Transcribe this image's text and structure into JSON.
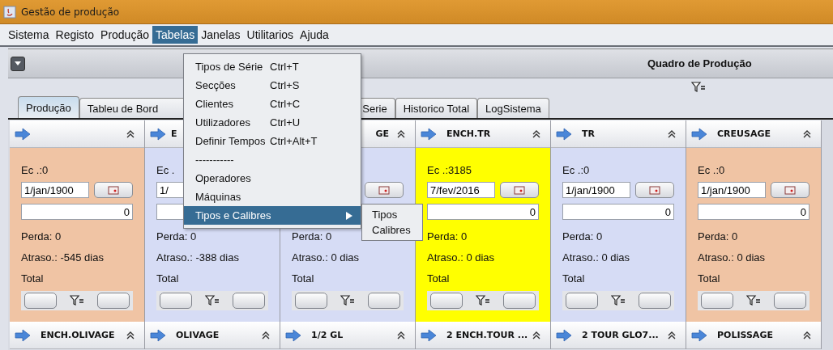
{
  "window": {
    "title": "Gestão de produção"
  },
  "menu_bar": [
    {
      "label": "Sistema",
      "selected": false
    },
    {
      "label": "Registo",
      "selected": false
    },
    {
      "label": "Produção",
      "selected": false
    },
    {
      "label": "Tabelas",
      "selected": true
    },
    {
      "label": "Janelas",
      "selected": false
    },
    {
      "label": "Utilitarios",
      "selected": false
    },
    {
      "label": "Ajuda",
      "selected": false
    }
  ],
  "open_menu": {
    "items": [
      {
        "kind": "item",
        "label": "Tipos de Série",
        "shortcut": "Ctrl+T",
        "selected": false
      },
      {
        "kind": "item",
        "label": "Secções",
        "shortcut": "Ctrl+S",
        "selected": false
      },
      {
        "kind": "item",
        "label": "Clientes",
        "shortcut": "Ctrl+C",
        "selected": false
      },
      {
        "kind": "item",
        "label": "Utilizadores",
        "shortcut": "Ctrl+U",
        "selected": false
      },
      {
        "kind": "item",
        "label": "Definir Tempos",
        "shortcut": "Ctrl+Alt+T",
        "selected": false
      },
      {
        "kind": "item",
        "label": "-----------",
        "selected": false
      },
      {
        "kind": "item",
        "label": "Operadores",
        "selected": false
      },
      {
        "kind": "item",
        "label": "Máquinas",
        "selected": false
      },
      {
        "kind": "submenu",
        "label": "Tipos  e Calibres",
        "selected": true
      }
    ]
  },
  "submenu": {
    "items": [
      {
        "label": "Tipos",
        "selected": false
      },
      {
        "label": "Calibres",
        "selected": false
      }
    ]
  },
  "frame": {
    "title": "Quadro de Produção"
  },
  "tabs": [
    {
      "label": "Produção",
      "selected": true
    },
    {
      "label": "Tableu de Bord",
      "selected": false
    },
    {
      "label": "Serie",
      "selected": false
    },
    {
      "label": "Historico Total",
      "selected": false
    },
    {
      "label": "LogSistema",
      "selected": false
    }
  ],
  "cards": [
    {
      "color": "#f0c4a4",
      "count": "Ec .:0",
      "date": "1/jan/1900",
      "quantity": "0",
      "loss": "Perda: 0",
      "delay": "Atraso.: -545 dias",
      "total": "Total"
    },
    {
      "title": "E",
      "color": "#d6dcf5",
      "count": "Ec .",
      "date": "1/",
      "loss": "Perda: 0",
      "delay": "Atraso.: -388 dias",
      "total": "Total"
    },
    {
      "title": "GE",
      "color": "#d6dcf5",
      "loss": "Perda: 0",
      "delay": "Atraso.: 0 dias",
      "total": "Total"
    },
    {
      "title": "ENCH.TR",
      "color": "#ffff00",
      "count": "Ec .:3185",
      "date": "7/fev/2016",
      "quantity": "0",
      "loss": "Perda: 0",
      "delay": "Atraso.: 0 dias",
      "total": "Total"
    },
    {
      "title": "TR",
      "color": "#d6dcf5",
      "count": "Ec .:0",
      "date": "1/jan/1900",
      "quantity": "0",
      "loss": "Perda: 0",
      "delay": "Atraso.: 0 dias",
      "total": "Total"
    },
    {
      "title": "CREUSAGE",
      "color": "#f0c4a4",
      "count": "Ec .:0",
      "date": "1/jan/1900",
      "quantity": "0",
      "loss": "Perda: 0",
      "delay": "Atraso.: 0 dias",
      "total": "Total"
    }
  ],
  "second_row": [
    {
      "title": "ENCH.OLIVAGE"
    },
    {
      "title": "OLIVAGE"
    },
    {
      "title": "1/2 GL"
    },
    {
      "title": "2 ENCH.TOUR ..."
    },
    {
      "title": "2 TOUR GLO7..."
    },
    {
      "title": "POLISSAGE"
    }
  ]
}
